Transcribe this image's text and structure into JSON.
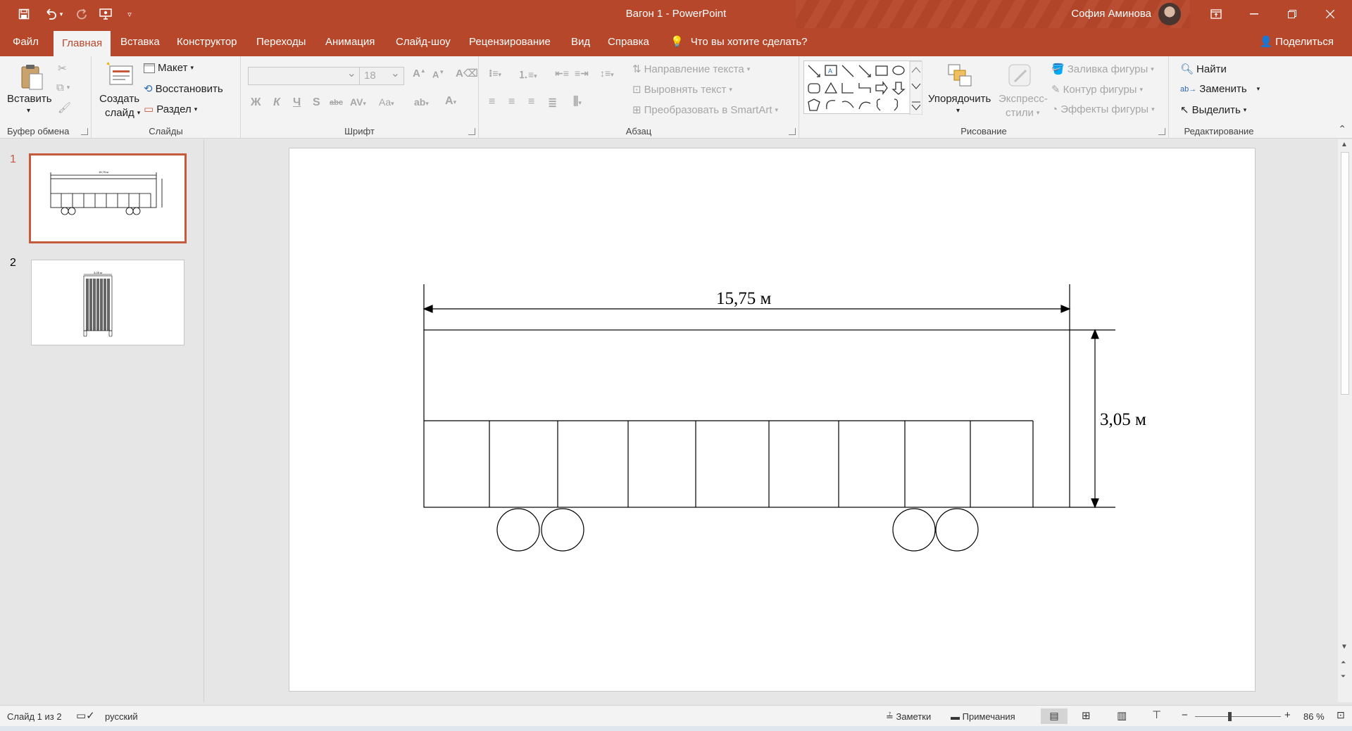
{
  "window": {
    "title": "Вагон 1  -  PowerPoint",
    "user": "София Аминова"
  },
  "tabs": [
    "Файл",
    "Главная",
    "Вставка",
    "Конструктор",
    "Переходы",
    "Анимация",
    "Слайд-шоу",
    "Рецензирование",
    "Вид",
    "Справка"
  ],
  "active_tab": "Главная",
  "tell_me": "Что вы хотите сделать?",
  "share_label": "Поделиться",
  "ribbon": {
    "clipboard": {
      "paste": "Вставить",
      "label": "Буфер обмена"
    },
    "slides": {
      "new_slide_1": "Создать",
      "new_slide_2": "слайд",
      "layout": "Макет",
      "reset": "Восстановить",
      "section": "Раздел",
      "label": "Слайды"
    },
    "font": {
      "font_size": "18",
      "label": "Шрифт"
    },
    "paragraph": {
      "text_direction": "Направление текста",
      "align_text": "Выровнять текст",
      "smartart": "Преобразовать в SmartArt",
      "label": "Абзац"
    },
    "drawing": {
      "arrange": "Упорядочить",
      "quick_styles_1": "Экспресс-",
      "quick_styles_2": "стили",
      "fill": "Заливка фигуры",
      "outline": "Контур фигуры",
      "effects": "Эффекты фигуры",
      "label": "Рисование"
    },
    "editing": {
      "find": "Найти",
      "replace": "Заменить",
      "select": "Выделить",
      "label": "Редактирование"
    }
  },
  "thumbnails": [
    {
      "number": "1",
      "thumb_label": "15,75 м"
    },
    {
      "number": "2",
      "thumb_label": "3,05 м"
    }
  ],
  "slide": {
    "width_label": "15,75 м",
    "height_label": "3,05 м"
  },
  "status": {
    "slide_info": "Слайд 1 из 2",
    "language": "русский",
    "notes": "Заметки",
    "comments": "Примечания",
    "zoom": "86 %"
  },
  "colors": {
    "accent": "#b7472a",
    "ribbon_bg": "#f3f3f3",
    "workspace_bg": "#e6e6e6"
  }
}
